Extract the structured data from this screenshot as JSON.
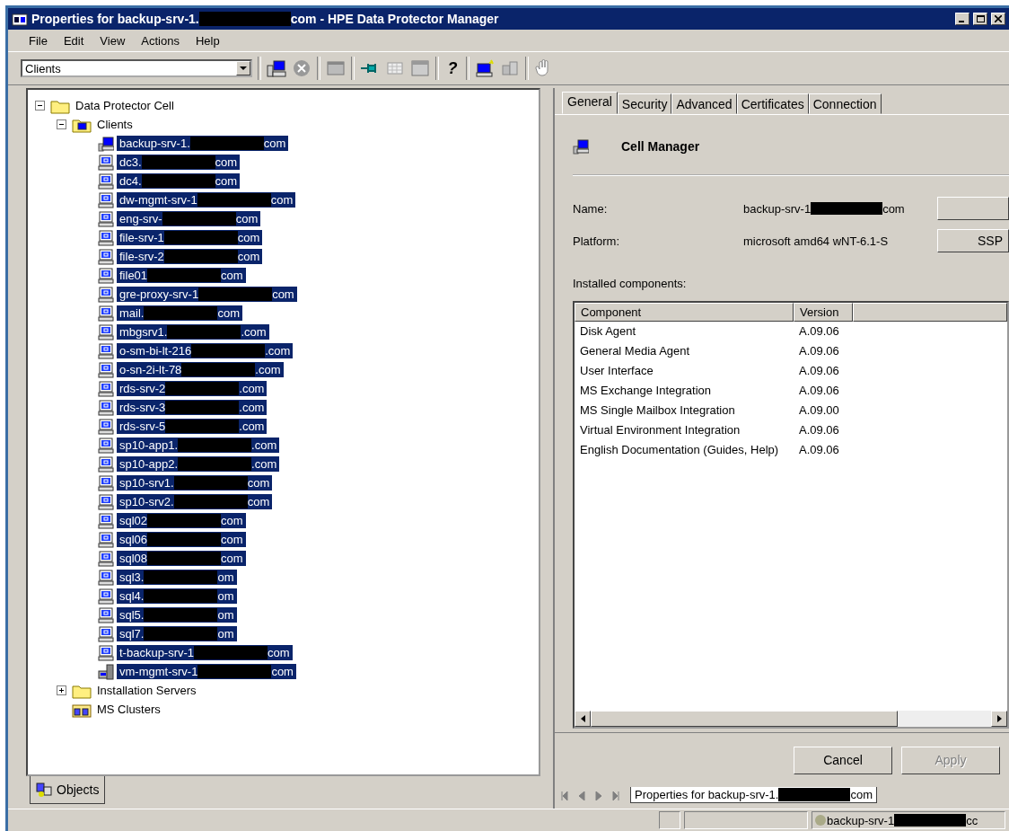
{
  "window": {
    "title_prefix": "Properties for backup-srv-1.",
    "title_suffix": "com - HPE Data Protector Manager"
  },
  "menu": [
    "File",
    "Edit",
    "View",
    "Actions",
    "Help"
  ],
  "toolbar": {
    "combo_value": "Clients",
    "help_glyph": "?"
  },
  "tree": {
    "root": "Data Protector Cell",
    "expanded": true,
    "children": [
      {
        "label": "Clients",
        "kind": "clients",
        "expanded": true,
        "children": [
          {
            "prefix": "backup-srv-1.",
            "suffix": "com",
            "kind": "manager",
            "selected": true
          },
          {
            "prefix": "dc3.",
            "suffix": "com",
            "kind": "client",
            "selected": true
          },
          {
            "prefix": "dc4.",
            "suffix": "com",
            "kind": "client",
            "selected": true
          },
          {
            "prefix": "dw-mgmt-srv-1",
            "suffix": "com",
            "kind": "client",
            "selected": true
          },
          {
            "prefix": "eng-srv-",
            "suffix": "com",
            "kind": "client",
            "selected": true
          },
          {
            "prefix": "file-srv-1",
            "suffix": "com",
            "kind": "client",
            "selected": true
          },
          {
            "prefix": "file-srv-2",
            "suffix": "com",
            "kind": "client",
            "selected": true
          },
          {
            "prefix": "file01",
            "suffix": "com",
            "kind": "client",
            "selected": true
          },
          {
            "prefix": "gre-proxy-srv-1",
            "suffix": "com",
            "kind": "client",
            "selected": true
          },
          {
            "prefix": "mail.",
            "suffix": "com",
            "kind": "client",
            "selected": true
          },
          {
            "prefix": "mbgsrv1.",
            "suffix": ".com",
            "kind": "client",
            "selected": true
          },
          {
            "prefix": "o-sm-bi-lt-216",
            "suffix": ".com",
            "kind": "client",
            "selected": true
          },
          {
            "prefix": "o-sn-2i-lt-78",
            "suffix": ".com",
            "kind": "client",
            "selected": true
          },
          {
            "prefix": "rds-srv-2",
            "suffix": ".com",
            "kind": "client",
            "selected": true
          },
          {
            "prefix": "rds-srv-3",
            "suffix": ".com",
            "kind": "client",
            "selected": true
          },
          {
            "prefix": "rds-srv-5",
            "suffix": ".com",
            "kind": "client",
            "selected": true
          },
          {
            "prefix": "sp10-app1.",
            "suffix": ".com",
            "kind": "client",
            "selected": true
          },
          {
            "prefix": "sp10-app2.",
            "suffix": ".com",
            "kind": "client",
            "selected": true
          },
          {
            "prefix": "sp10-srv1.",
            "suffix": "com",
            "kind": "client",
            "selected": true
          },
          {
            "prefix": "sp10-srv2.",
            "suffix": "com",
            "kind": "client",
            "selected": true
          },
          {
            "prefix": "sql02",
            "suffix": "com",
            "kind": "client",
            "selected": true
          },
          {
            "prefix": "sql06",
            "suffix": "com",
            "kind": "client",
            "selected": true
          },
          {
            "prefix": "sql08",
            "suffix": "com",
            "kind": "client",
            "selected": true
          },
          {
            "prefix": "sql3.",
            "suffix": "om",
            "kind": "client",
            "selected": true
          },
          {
            "prefix": "sql4.",
            "suffix": "om",
            "kind": "client",
            "selected": true
          },
          {
            "prefix": "sql5.",
            "suffix": "om",
            "kind": "client",
            "selected": true
          },
          {
            "prefix": "sql7.",
            "suffix": "om",
            "kind": "client",
            "selected": true
          },
          {
            "prefix": "t-backup-srv-1",
            "suffix": "com",
            "kind": "client",
            "selected": true
          },
          {
            "prefix": "vm-mgmt-srv-1",
            "suffix": "com",
            "kind": "vm",
            "selected": true
          }
        ]
      },
      {
        "label": "Installation Servers",
        "kind": "folder",
        "expanded": false
      },
      {
        "label": "MS Clusters",
        "kind": "clusters"
      }
    ]
  },
  "left_tab": "Objects",
  "tabs": [
    {
      "label": "General",
      "selected": true
    },
    {
      "label": "Security",
      "selected": false
    },
    {
      "label": "Advanced",
      "selected": false
    },
    {
      "label": "Certificates",
      "selected": false
    },
    {
      "label": "Connection",
      "selected": false
    }
  ],
  "header": "Cell Manager",
  "fields": [
    {
      "label": "Name:",
      "prefix": "backup-srv-1",
      "suffix": "com"
    },
    {
      "label": "Platform:",
      "value": "microsoft amd64 wNT-6.1-S",
      "button": "SSP"
    }
  ],
  "components_label": "Installed components:",
  "table": {
    "columns": [
      "Component",
      "Version"
    ],
    "rows": [
      [
        "Disk Agent",
        "A.09.06"
      ],
      [
        "General Media Agent",
        "A.09.06"
      ],
      [
        "User Interface",
        "A.09.06"
      ],
      [
        "MS Exchange Integration",
        "A.09.06"
      ],
      [
        "MS Single Mailbox Integration",
        "A.09.00"
      ],
      [
        "Virtual Environment Integration",
        "A.09.06"
      ],
      [
        "English Documentation (Guides, Help)",
        "A.09.06"
      ]
    ]
  },
  "buttons": [
    {
      "label": "Cancel",
      "disabled": false
    },
    {
      "label": "Apply",
      "disabled": true
    }
  ],
  "doc_tab": {
    "prefix": "Properties for backup-srv-1.",
    "suffix": "com"
  },
  "status": {
    "prefix": "backup-srv-1",
    "suffix": "cc"
  }
}
